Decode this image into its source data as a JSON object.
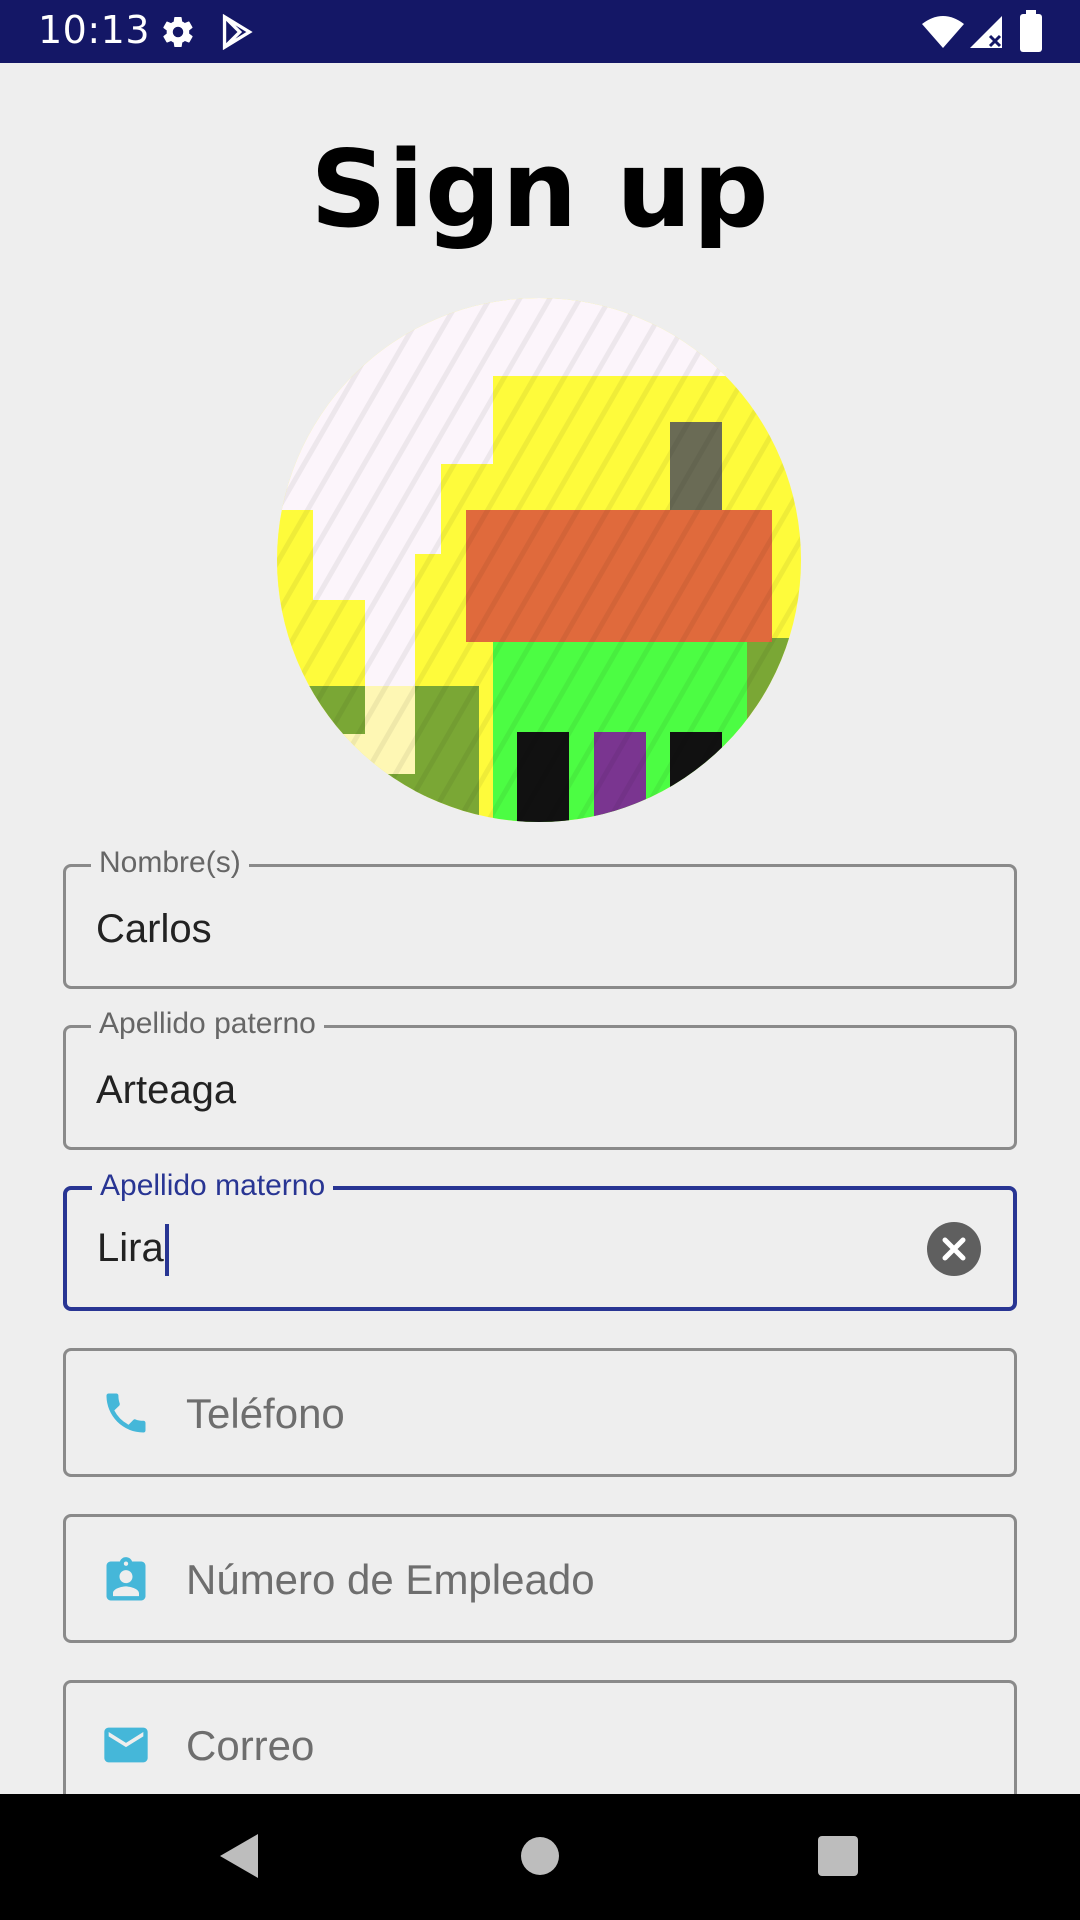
{
  "status_bar": {
    "time": "10:13",
    "icons": [
      "gear-icon",
      "play-store-icon",
      "wifi-icon",
      "cell-signal-icon",
      "battery-icon"
    ],
    "background": "#141766"
  },
  "title": "Sign up",
  "avatar": {
    "icon": "pixel-art-avatar",
    "colors": [
      "#fcf5fb",
      "#fefb3b",
      "#e06a3c",
      "#4cfd43",
      "#7aa735",
      "#7a3590",
      "#6a6b55",
      "#111111"
    ]
  },
  "form": {
    "first_name": {
      "label": "Nombre(s)",
      "value": "Carlos"
    },
    "last_name_paternal": {
      "label": "Apellido paterno",
      "value": "Arteaga"
    },
    "last_name_maternal": {
      "label": "Apellido materno",
      "value": "Lira",
      "clear_icon": "clear-icon"
    },
    "phone": {
      "placeholder": "Teléfono",
      "icon": "phone-icon"
    },
    "employee_number": {
      "placeholder": "Número de Empleado",
      "icon": "badge-icon"
    },
    "email": {
      "placeholder": "Correo",
      "icon": "mail-icon"
    }
  },
  "colors": {
    "accent": "#283593",
    "icon_tint": "#45b7d9",
    "outline": "#8a8a8a"
  },
  "nav_bar": {
    "icons": [
      "back-icon",
      "home-icon",
      "recents-icon"
    ]
  }
}
